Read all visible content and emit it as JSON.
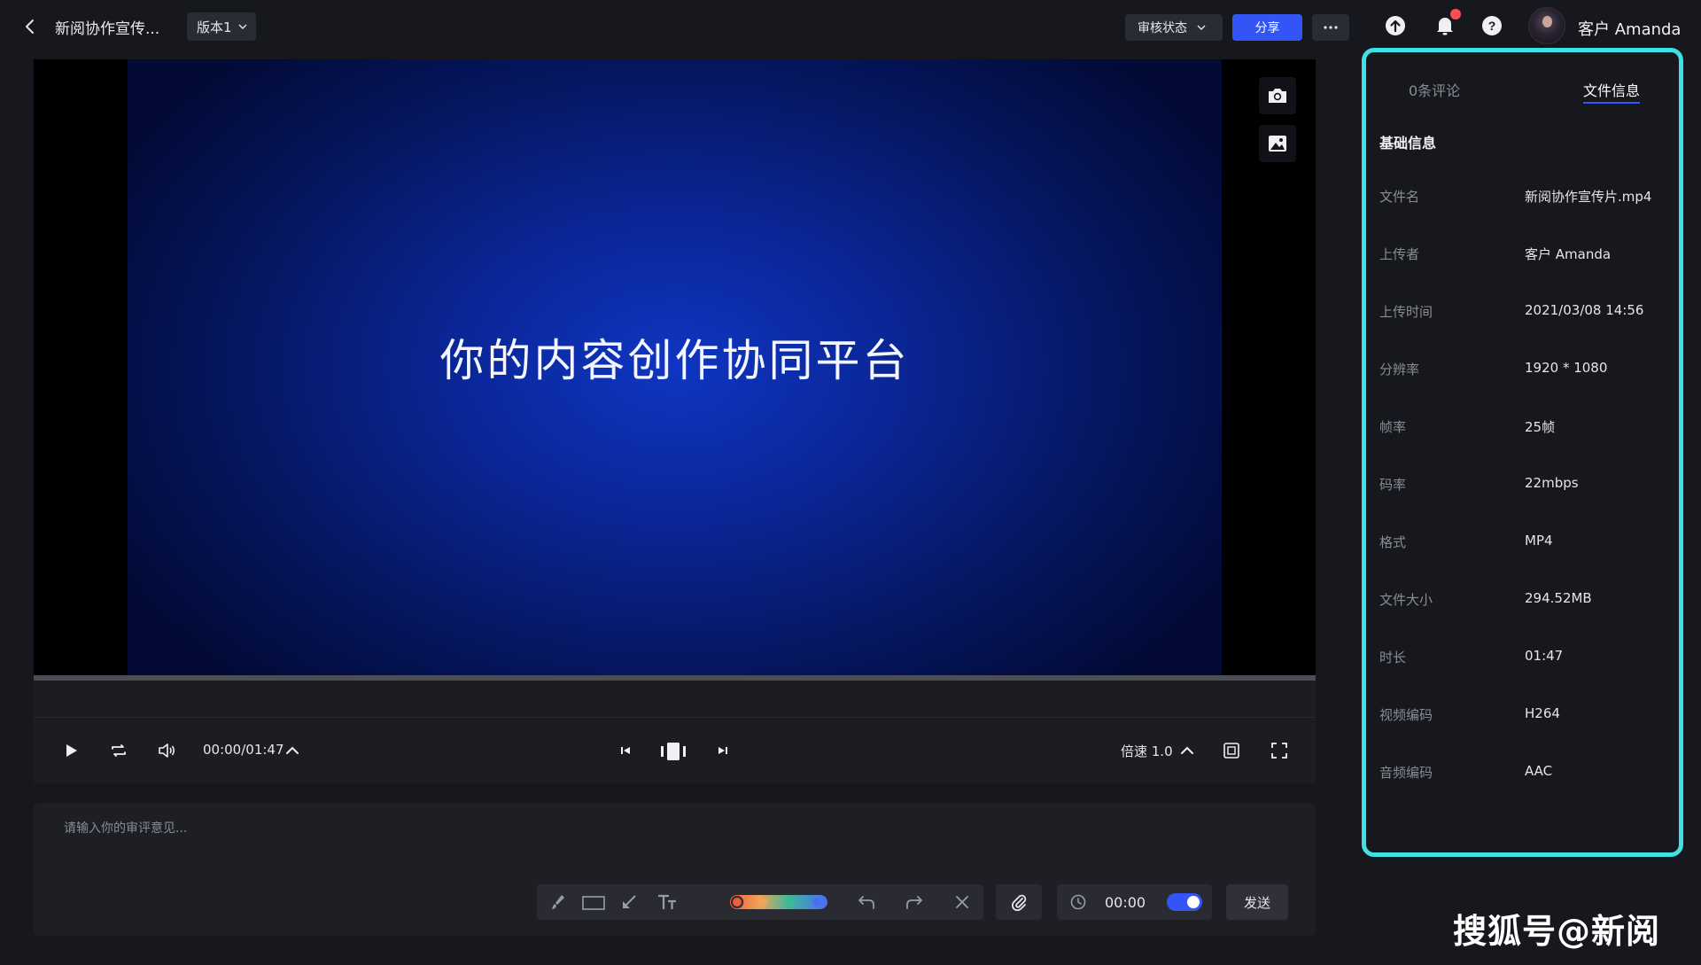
{
  "header": {
    "title": "新阅协作宣传...",
    "version_label": "版本1",
    "review_status_label": "审核状态",
    "share_label": "分享",
    "username": "客户 Amanda"
  },
  "player": {
    "video_caption": "你的内容创作协同平台",
    "current_time": "00:00/01:47",
    "speed_label": "倍速 1.0",
    "progress": 0
  },
  "comment": {
    "placeholder": "请输入你的审评意见...",
    "timestamp": "00:00",
    "timestamp_enabled": true,
    "send_label": "发送",
    "palette": [
      "#e8613c",
      "#f0a35a",
      "#3fb89a",
      "#4a6cf7"
    ]
  },
  "panel": {
    "tabs": [
      {
        "label": "0条评论",
        "active": false
      },
      {
        "label": "文件信息",
        "active": true
      }
    ],
    "section_title": "基础信息",
    "rows": [
      {
        "label": "文件名",
        "value": "新阅协作宣传片.mp4"
      },
      {
        "label": "上传者",
        "value": "客户 Amanda"
      },
      {
        "label": "上传时间",
        "value": "2021/03/08 14:56"
      },
      {
        "label": "分辨率",
        "value": "1920 * 1080"
      },
      {
        "label": "帧率",
        "value": "25帧"
      },
      {
        "label": "码率",
        "value": "22mbps"
      },
      {
        "label": "格式",
        "value": "MP4"
      },
      {
        "label": "文件大小",
        "value": "294.52MB"
      },
      {
        "label": "时长",
        "value": "01:47"
      },
      {
        "label": "视频编码",
        "value": "H264"
      },
      {
        "label": "音频编码",
        "value": "AAC"
      }
    ]
  },
  "watermark": "搜狐号@新阅",
  "colors": {
    "accent": "#3355f6",
    "panel_highlight": "#3fe0e6",
    "notification": "#ff4d4f"
  }
}
